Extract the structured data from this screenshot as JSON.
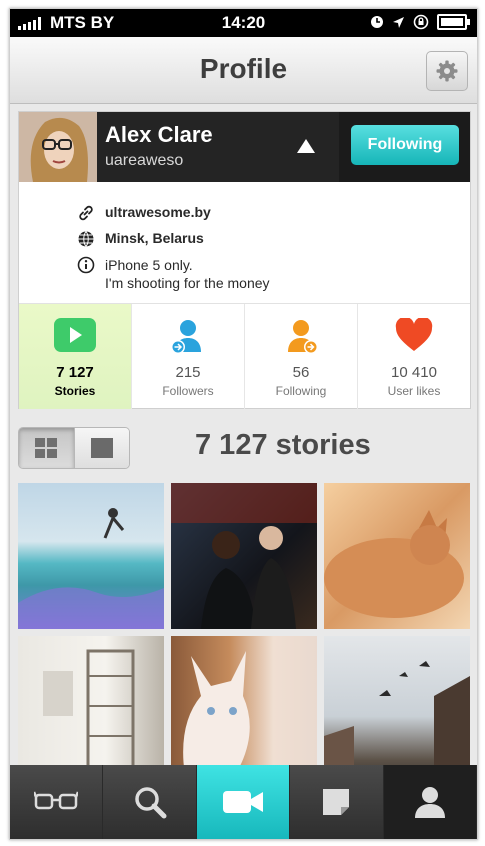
{
  "status_bar": {
    "carrier": "MTS BY",
    "time": "14:20"
  },
  "nav": {
    "title": "Profile",
    "settings_icon": "gear-icon"
  },
  "profile": {
    "name": "Alex Clare",
    "username": "uareaweso",
    "follow_label": "Following",
    "website": "ultrawesome.by",
    "location": "Minsk, Belarus",
    "bio_line1": "iPhone 5 only.",
    "bio_line2": "I'm shooting for the money"
  },
  "stats": [
    {
      "value": "7 127",
      "label": "Stories",
      "icon": "play-icon",
      "color": "#3ecb6a"
    },
    {
      "value": "215",
      "label": "Followers",
      "icon": "followers-icon",
      "color": "#2aa3dd"
    },
    {
      "value": "56",
      "label": "Following",
      "icon": "following-icon",
      "color": "#f39a1e"
    },
    {
      "value": "10 410",
      "label": "User likes",
      "icon": "heart-icon",
      "color": "#ef4a24"
    }
  ],
  "stories_count": "7 127 stories",
  "tabs": [
    "glasses-icon",
    "search-icon",
    "camera-icon",
    "notes-icon",
    "profile-icon"
  ]
}
